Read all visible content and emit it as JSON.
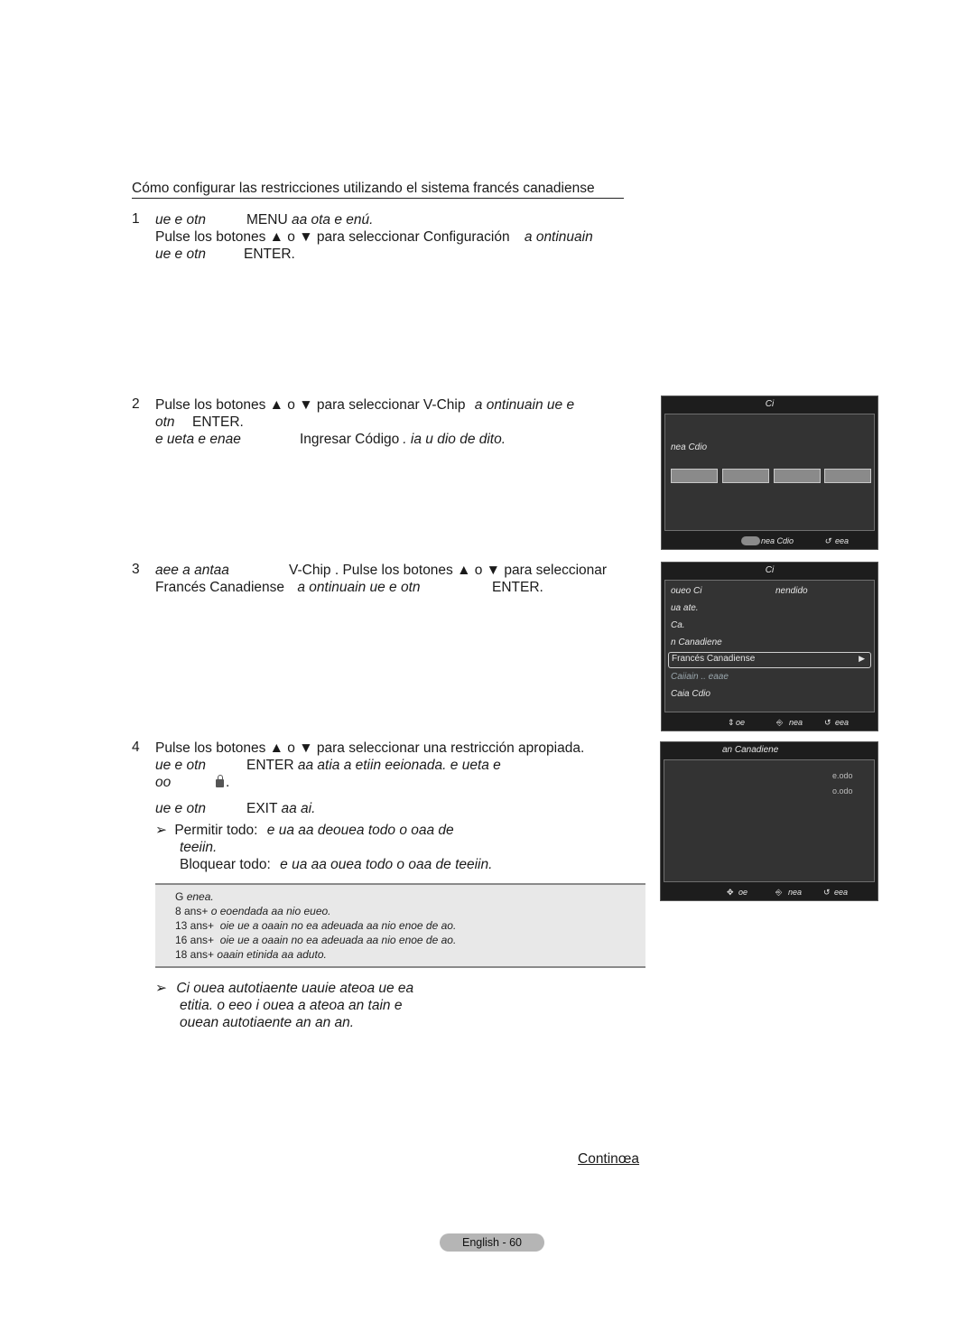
{
  "section_title": "Cómo configurar las restricciones utilizando el sistema francés canadiense",
  "steps": [
    {
      "number": "1",
      "lines": [
        {
          "a": "ue e otn",
          "b": "MENU",
          "c": "aa ota e enú."
        },
        {
          "a": "Pulse los botones ▲ o ▼ para seleccionar Configuración",
          "b": "a ontinuain"
        },
        {
          "a": "ue e otn",
          "b": "ENTER."
        }
      ]
    },
    {
      "number": "2",
      "lines": [
        {
          "a": "Pulse los botones ▲ o ▼ para seleccionar V-Chip",
          "b": "a ontinuain ue e"
        },
        {
          "a": "otn",
          "b": "ENTER."
        },
        {
          "a": "e ueta e enae",
          "b": "Ingresar Código",
          "c": ". ia u dio  de  dito."
        }
      ]
    },
    {
      "number": "3",
      "lines": [
        {
          "a": "aee a antaa",
          "b": "V-Chip . Pulse los botones ▲ o ▼ para seleccionar"
        },
        {
          "a": "Francés Canadiense",
          "b": "a ontinuain ue e otn",
          "c": "ENTER."
        }
      ]
    },
    {
      "number": "4",
      "lines": [
        {
          "a": "Pulse los botones ▲ o ▼ para seleccionar una restricción apropiada."
        },
        {
          "a": "ue e otn",
          "b": "ENTER",
          "c": "aa atia a etiin eeionada. e ueta e"
        },
        {
          "a": "oo",
          "b": "."
        },
        {
          "a": "ue e otn",
          "b": "EXIT",
          "c": "aa ai."
        }
      ],
      "notes": [
        {
          "label": "Permitir todo:",
          "text": "e ua aa deouea todo o oaa de",
          "text2": "teeiin."
        },
        {
          "label": "Bloquear todo:",
          "text": "e ua aa ouea todo o oaa de teeiin."
        }
      ]
    }
  ],
  "ratings_table": [
    {
      "rating": "G",
      "desc": "enea."
    },
    {
      "rating": "8 ans+",
      "desc": "o eoendada aa nio eueo."
    },
    {
      "rating": "13 ans+",
      "desc": "oie ue a oaain no ea adeuada aa nio enoe de  ao."
    },
    {
      "rating": "16 ans+",
      "desc": "oie ue a oaain no ea adeuada aa nio enoe de  ao."
    },
    {
      "rating": "18 ans+",
      "desc": "oaain etinida aa aduto."
    }
  ],
  "final_note": [
    "Ci ouea autotiaente uauie ateoa ue ea",
    "etitia. o eeo i ouea a ateoa  an tain e",
    "ouean autotiaente  an  an   an."
  ],
  "continue_label": "Continœa",
  "page_label": "English - 60",
  "osd1": {
    "title": "Ci",
    "prompt": "nea Cdio",
    "code_boxes": 4,
    "footer": {
      "enter_label": "nea Cdio",
      "return_label": "eea"
    }
  },
  "osd2": {
    "title": "Ci",
    "items": [
      {
        "label": "oueo Ci",
        "value": "nendido"
      },
      {
        "label": "ua ate.",
        "value": ""
      },
      {
        "label": "Ca.",
        "value": ""
      },
      {
        "label": "n Canadiene",
        "value": ""
      },
      {
        "label": "Francés Canadiense",
        "value": "",
        "selected": true
      },
      {
        "label": "Caiiain .. eaae",
        "value": "",
        "dim": true
      },
      {
        "label": "Caia Cdio",
        "value": ""
      }
    ],
    "footer": {
      "move_label": "oe",
      "enter_label": "nea",
      "return_label": "eea"
    }
  },
  "osd3": {
    "title": "an Canadiene",
    "options": [
      "e.odo",
      "o.odo"
    ],
    "footer": {
      "move_label": "oe",
      "enter_label": "nea",
      "return_label": "eea"
    }
  }
}
